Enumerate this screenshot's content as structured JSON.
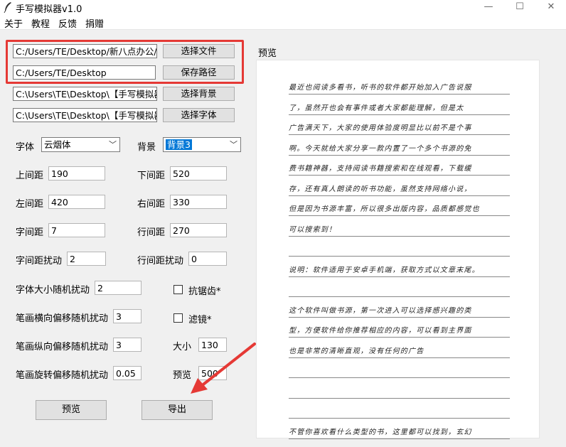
{
  "window": {
    "title": "手写模拟器v1.0",
    "minimize_icon": "minimize-icon",
    "maximize_icon": "maximize-icon",
    "close_icon": "close-icon",
    "minimize_glyph": "—",
    "maximize_glyph": "☐",
    "close_glyph": "✕"
  },
  "menu": [
    {
      "label": "关于"
    },
    {
      "label": "教程"
    },
    {
      "label": "反馈"
    },
    {
      "label": "捐赠"
    }
  ],
  "files": {
    "text_file_path": "C:/Users/TE/Desktop/新八点办公/(",
    "select_file_label": "选择文件",
    "save_path": "C:/Users/TE/Desktop",
    "save_path_label": "保存路径",
    "background_path": "C:\\Users\\TE\\Desktop\\【手写模拟器",
    "select_background_label": "选择背景",
    "font_path": "C:\\Users\\TE\\Desktop\\【手写模拟器",
    "select_font_label": "选择字体"
  },
  "settings": {
    "font_label": "字体",
    "font_value": "云烟体",
    "background_label": "背景",
    "background_value": "背景3",
    "top_margin_label": "上间距",
    "top_margin": "190",
    "bottom_margin_label": "下间距",
    "bottom_margin": "520",
    "left_margin_label": "左间距",
    "left_margin": "420",
    "right_margin_label": "右间距",
    "right_margin": "330",
    "char_spacing_label": "字间距",
    "char_spacing": "7",
    "line_spacing_label": "行间距",
    "line_spacing": "270",
    "char_spacing_jitter_label": "字间距扰动",
    "char_spacing_jitter": "2",
    "line_spacing_jitter_label": "行间距扰动",
    "line_spacing_jitter": "0",
    "font_size_jitter_label": "字体大小随机扰动",
    "font_size_jitter": "2",
    "antialias_label": "抗锯齿*",
    "stroke_h_jitter_label": "笔画横向偏移随机扰动",
    "stroke_h_jitter": "3",
    "filter_label": "滤镜*",
    "stroke_v_jitter_label": "笔画纵向偏移随机扰动",
    "stroke_v_jitter": "3",
    "size_label": "大小",
    "size": "130",
    "stroke_rot_jitter_label": "笔画旋转偏移随机扰动",
    "stroke_rot_jitter": "0.05",
    "preview_size_label": "预览",
    "preview_size": "500"
  },
  "actions": {
    "preview_label": "预览",
    "export_label": "导出"
  },
  "preview": {
    "label": "预览",
    "lines": [
      "最近也阅读多看书，听书的软件都开始加入广告说服",
      "了，虽然开也会有事件或者大家都能理解，但是太",
      "广告满天下，大家的使用体验度明显比以前不是个事",
      "啊。今天就给大家分享一款内置了一个多个书源的免",
      "费书籍神器，支持阅读书籍搜索和在线观看，下载缓",
      "存，还有真人朗读的听书功能，虽然支持网络小说，",
      "但是因为书源丰富，所以很多出版内容，品质都感觉也",
      "可以搜索到！",
      "",
      "说明：软件适用于安卓手机端，获取方式以文章末尾。",
      "",
      "这个软件叫做书源，第一次进入可以选择感兴趣的类",
      "型，方便软件给你推荐相应的内容，可以看到主界面",
      "也是非常的清晰直观，没有任何的广告",
      "",
      "",
      "",
      "不管你喜欢看什么类型的书，这里都可以找到，玄幻"
    ]
  },
  "colors": {
    "highlight": "#e53935",
    "selection": "#0078d7",
    "arrow": "#e53935"
  }
}
